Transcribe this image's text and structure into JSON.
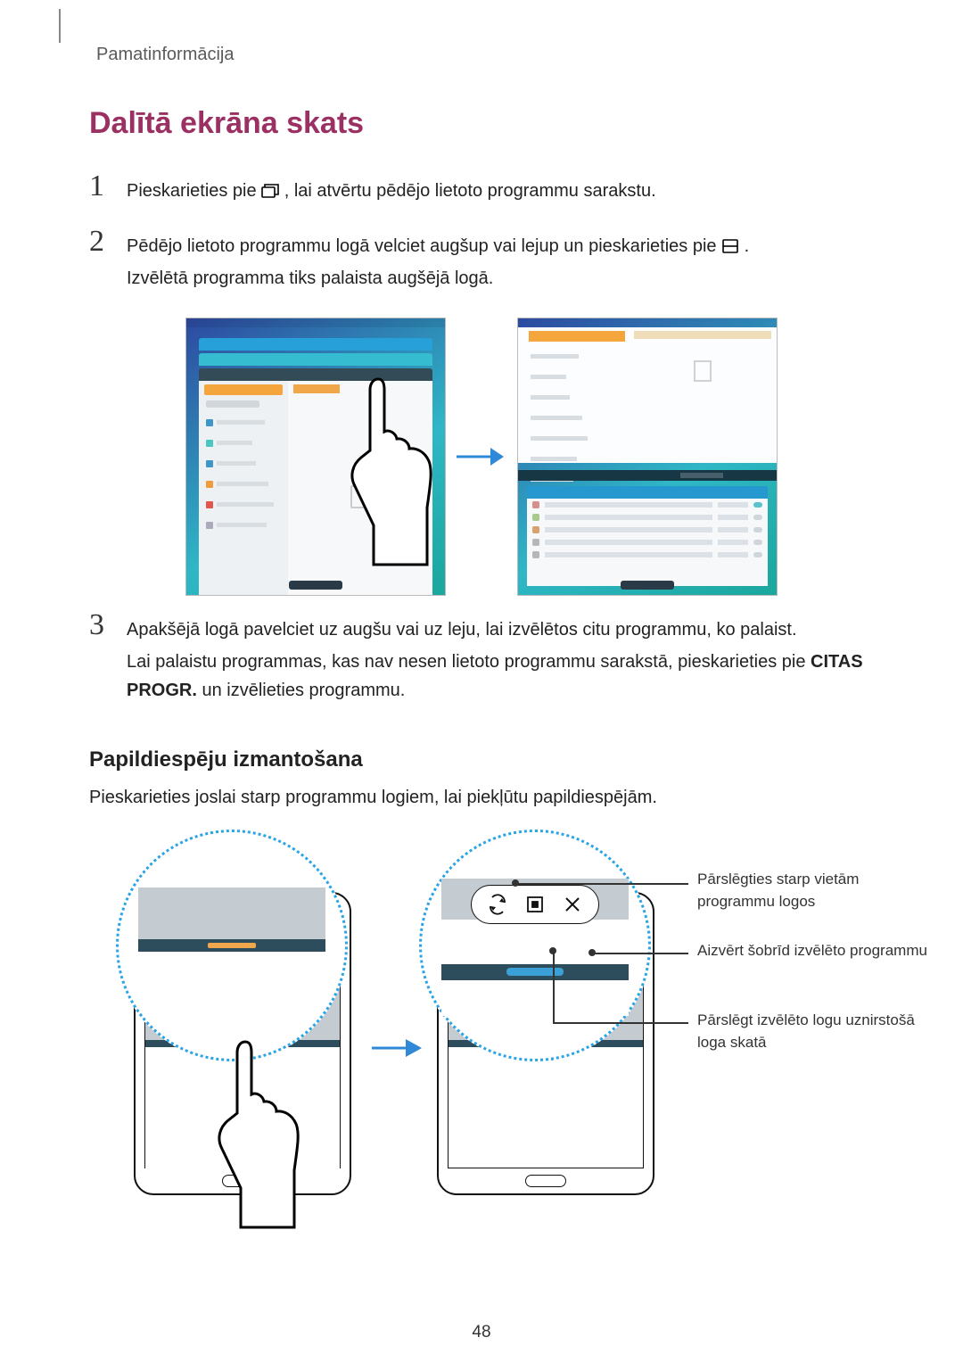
{
  "breadcrumb": "Pamatinformācija",
  "title": "Dalītā ekrāna skats",
  "steps": {
    "s1": {
      "textA": "Pieskarieties pie ",
      "textB": ", lai atvērtu pēdējo lietoto programmu sarakstu."
    },
    "s2": {
      "textA": "Pēdējo lietoto programmu logā velciet augšup vai lejup un pieskarieties pie ",
      "textB": ".",
      "textC": "Izvēlētā programma tiks palaista augšējā logā."
    },
    "s3": {
      "textA": "Apakšējā logā pavelciet uz augšu vai uz leju, lai izvēlētos citu programmu, ko palaist.",
      "textB": "Lai palaistu programmas, kas nav nesen lietoto programmu sarakstā, pieskarieties pie ",
      "citas": "CITAS PROGR.",
      "textC": " un izvēlieties programmu."
    }
  },
  "subheading": "Papildiespēju izmantošana",
  "sub_para": "Pieskarieties joslai starp programmu logiem, lai piekļūtu papildiespējām.",
  "callouts": {
    "swap": "Pārslēgties starp vietām programmu logos",
    "close": "Aizvērt šobrīd izvēlēto programmu",
    "popup": "Pārslēgt izvēlēto logu uznirstošā loga skatā"
  },
  "step_numbers": {
    "one": "1",
    "two": "2",
    "three": "3"
  },
  "page_number": "48"
}
